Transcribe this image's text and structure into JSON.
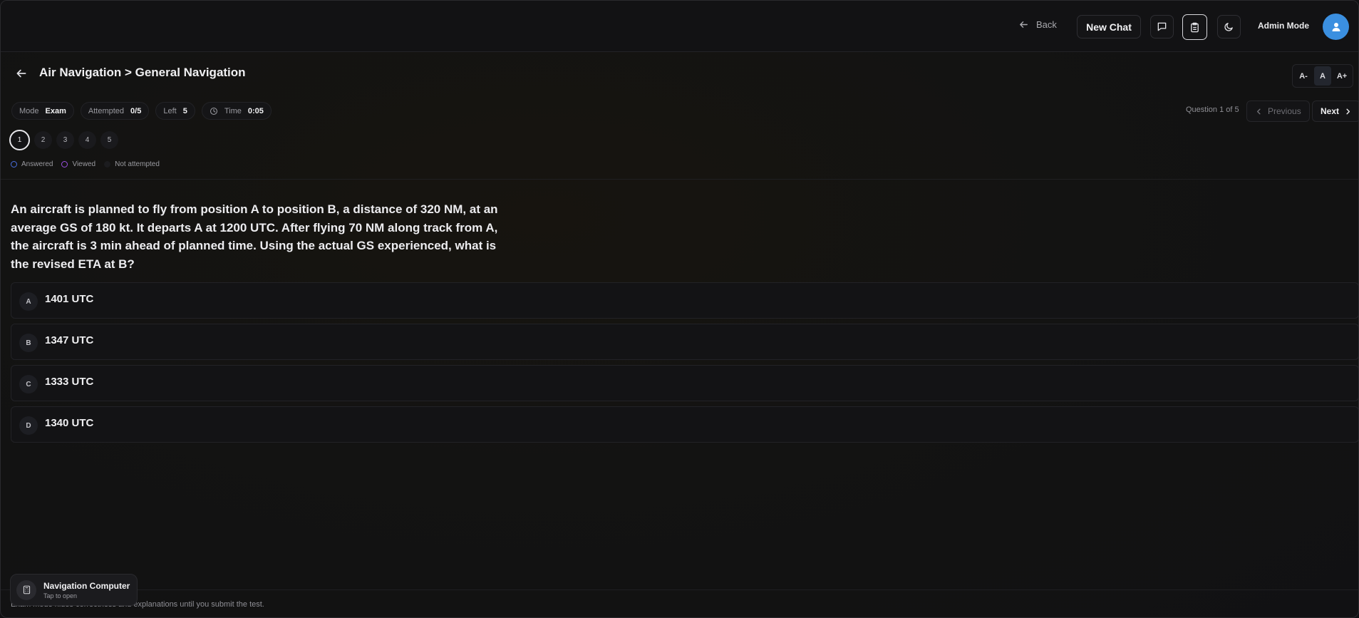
{
  "header": {
    "back_label": "Back",
    "new_chat_label": "New Chat",
    "admin_label": "Admin Mode"
  },
  "title": {
    "text": "Air Navigation > General Navigation"
  },
  "font_size_controls": [
    "A-",
    "A",
    "A+"
  ],
  "stats": {
    "mode_key": "Mode",
    "mode_value": "Exam",
    "attempted_key": "Attempted",
    "attempted_value": "0/5",
    "left_key": "Left",
    "left_value": "5",
    "time_key": "Time",
    "time_value": "0:05"
  },
  "navigation": {
    "question_count": "Question 1 of 5",
    "previous_label": "Previous",
    "next_label": "Next"
  },
  "question_numbers": [
    "1",
    "2",
    "3",
    "4",
    "5"
  ],
  "legend": {
    "answered": "Answered",
    "viewed": "Viewed",
    "not_attempted": "Not attempted"
  },
  "question": {
    "text": "An aircraft is planned to fly from position A to position B, a distance of 320 NM, at an average GS of 180 kt. It departs A at 1200 UTC. After flying 70 NM along track from A, the aircraft is 3 min ahead of planned time. Using the actual GS experienced, what is the revised ETA at B?",
    "options": [
      {
        "letter": "A",
        "text": "1401 UTC"
      },
      {
        "letter": "B",
        "text": "1347 UTC"
      },
      {
        "letter": "C",
        "text": "1333 UTC"
      },
      {
        "letter": "D",
        "text": "1340 UTC"
      }
    ]
  },
  "footer": {
    "note": "Exam mode hides correctness and explanations until you submit the test."
  },
  "nav_computer": {
    "title": "Navigation Computer",
    "subtitle": "Tap to open"
  },
  "colors": {
    "avatar": "#3b8fe0",
    "answered": "#4a6fe0",
    "viewed": "#9a4fe0"
  }
}
